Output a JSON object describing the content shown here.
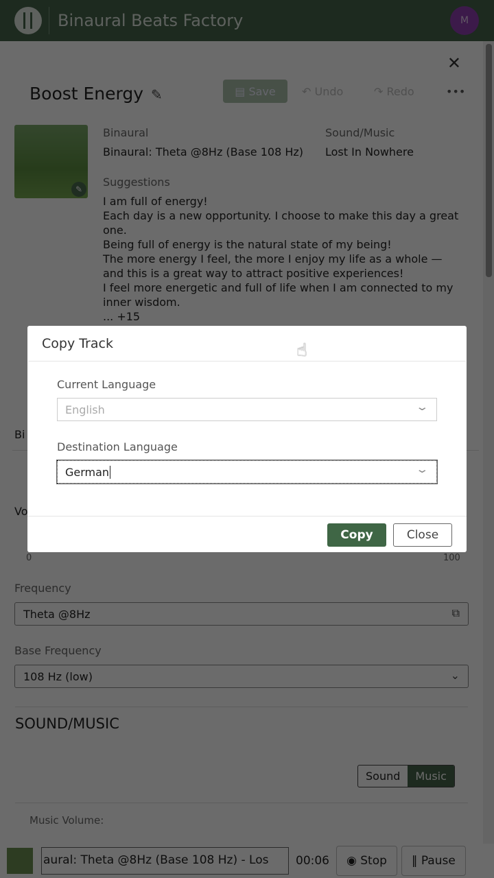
{
  "header": {
    "app_title": "Binaural Beats Factory",
    "avatar_initial": "M"
  },
  "track": {
    "title": "Boost Energy",
    "toolbar": {
      "save": "Save",
      "undo": "Undo",
      "redo": "Redo",
      "more": "•••"
    },
    "binaural_label": "Binaural",
    "binaural_value": "Binaural: Theta @8Hz (Base 108 Hz)",
    "sound_label": "Sound/Music",
    "sound_value": "Lost In Nowhere",
    "suggestions_label": "Suggestions",
    "suggestions": [
      "I am full of energy!",
      "Each day is a new opportunity. I choose to make this day a great one.",
      "Being full of energy is the natural state of my being!",
      "The more energy I feel, the more I enjoy my life as a whole — and this is a great way to attract positive experiences!",
      "I feel more energetic and full of life when I am connected to my inner wisdom.",
      "... +15"
    ]
  },
  "binaural_tab": {
    "tab_partial": "Bi",
    "volume_partial": "Vo",
    "slider_min": "0",
    "slider_max": "100",
    "frequency_label": "Frequency",
    "frequency_value": "Theta @8Hz",
    "base_label": "Base Frequency",
    "base_value": "108 Hz (low)"
  },
  "sound_section": {
    "title": "SOUND/MUSIC",
    "toggle": [
      "Sound",
      "Music"
    ],
    "selected": "Music",
    "music_volume_label": "Music Volume:"
  },
  "player": {
    "marquee": "aural: Theta @8Hz (Base 108 Hz) - Los",
    "time": "00:06",
    "stop": "Stop",
    "pause": "Pause"
  },
  "dialog": {
    "title": "Copy Track",
    "current_label": "Current Language",
    "current_value": "English",
    "dest_label": "Destination Language",
    "dest_value": "German",
    "copy": "Copy",
    "close": "Close"
  },
  "colors": {
    "brand": "#44644a",
    "avatar": "#8e3fb0"
  }
}
